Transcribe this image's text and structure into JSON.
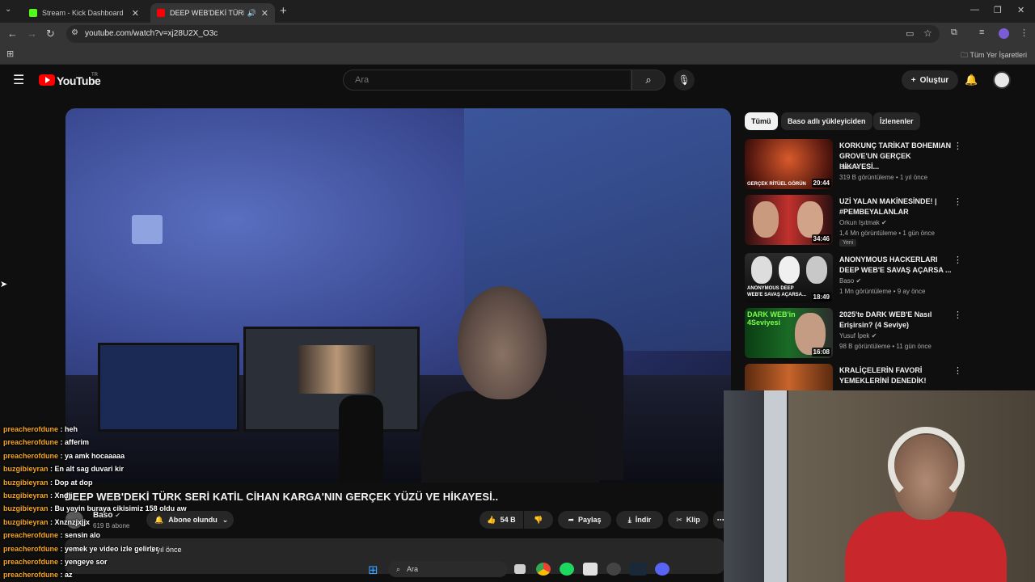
{
  "browser": {
    "tabs": [
      {
        "title": "Stream - Kick Dashboard",
        "favicon_color": "#53fc18"
      },
      {
        "title": "DEEP WEB'DEKİ TÜRK SERİ",
        "favicon_color": "#ff0000"
      }
    ],
    "url": "youtube.com/watch?v=xj28U2X_O3c",
    "bookmarks_label": "Tüm Yer İşaretleri"
  },
  "youtube": {
    "wordmark": "YouTube",
    "region": "TR",
    "search_placeholder": "Ara",
    "create_label": "Oluştur"
  },
  "video": {
    "title": "DEEP WEB'DEKİ TÜRK SERİ KATİL CİHAN KARGA'NIN GERÇEK YÜZÜ VE HİKAYESİ..",
    "channel": "Baso",
    "subscribers": "619 B abone",
    "subscribe_label": "Abone olundu",
    "likes": "54 B",
    "share_label": "Paylaş",
    "download_label": "İndir",
    "clip_label": "Klip",
    "posted": "1 yıl önce"
  },
  "chips": [
    "Tümü",
    "Baso adlı yükleyiciden",
    "İzlenenler"
  ],
  "recommendations": [
    {
      "title": "KORKUNÇ TARİKAT BOHEMIAN GROVE'UN GERÇEK HİKAYESİ...",
      "channel": "Baso",
      "meta": "319 B görüntüleme • 1 yıl önce",
      "duration": "20:44",
      "thumb_text": "GERÇEK RİTÜEL GÖRÜN",
      "badge": ""
    },
    {
      "title": "UZİ YALAN MAKİNESİNDE! | #PEMBEYALANLAR",
      "channel": "Orkun Işıtmak",
      "meta": "1,4 Mn görüntüleme • 1 gün önce",
      "duration": "34:46",
      "thumb_text": "",
      "badge": "Yeni"
    },
    {
      "title": "ANONYMOUS HACKERLARI DEEP WEB'E SAVAŞ AÇARSA ...",
      "channel": "Baso",
      "meta": "1 Mn görüntüleme • 9 ay önce",
      "duration": "18:49",
      "thumb_text": "ANONYMOUS DEEP WEB'E SAVAŞ AÇARSA...",
      "badge": ""
    },
    {
      "title": "2025'te DARK WEB'E Nasıl Erişirsin? (4 Seviye)",
      "channel": "Yusuf İpek",
      "meta": "98 B görüntüleme • 11 gün önce",
      "duration": "16:08",
      "thumb_text": "DARK WEB'in 4Seviyesi",
      "badge": ""
    },
    {
      "title": "KRALİÇELERİN FAVORİ YEMEKLERİNİ DENEDİK!",
      "channel": "",
      "meta": "",
      "duration": "",
      "thumb_text": "",
      "badge": ""
    }
  ],
  "chat": [
    {
      "user": "preacherofdune",
      "msg": "heh"
    },
    {
      "user": "preacherofdune",
      "msg": "afferim"
    },
    {
      "user": "preacherofdune",
      "msg": "ya amk hocaaaaa"
    },
    {
      "user": "buzgibieyran",
      "msg": "En alt sag duvari kir"
    },
    {
      "user": "buzgibieyran",
      "msg": "Dop at dop"
    },
    {
      "user": "buzgibieyran",
      "msg": "Xndjj"
    },
    {
      "user": "buzgibieyran",
      "msg": "Bu yayin buraya cikisimiz 158 oldu aw"
    },
    {
      "user": "buzgibieyran",
      "msg": "Xnznzjxjjx"
    },
    {
      "user": "preacherofdune",
      "msg": "sensin alo"
    },
    {
      "user": "preacherofdune",
      "msg": "yemek ye video izle gelirler"
    },
    {
      "user": "preacherofdune",
      "msg": "yengeye sor"
    },
    {
      "user": "preacherofdune",
      "msg": "az"
    }
  ],
  "taskbar": {
    "search_label": "Ara"
  },
  "colors": {
    "accent": "#ff0000",
    "chat_user": "#f5a623",
    "bg": "#0f0f0f"
  }
}
